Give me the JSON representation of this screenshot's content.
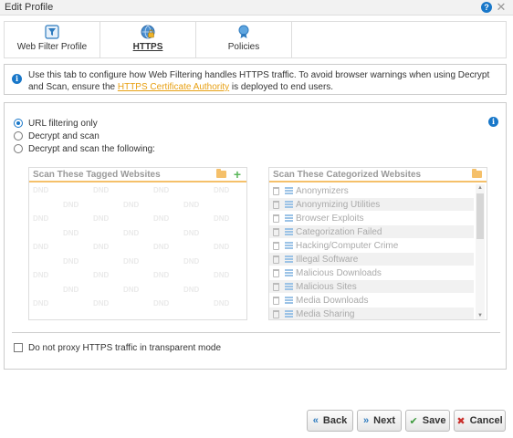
{
  "window": {
    "title": "Edit Profile",
    "help_label": "?",
    "close_label": "✕"
  },
  "tabs": [
    {
      "label": "Web Filter Profile",
      "icon": "funnel-icon",
      "active": false
    },
    {
      "label": "HTTPS",
      "icon": "lock-globe-icon",
      "active": true
    },
    {
      "label": "Policies",
      "icon": "ribbon-icon",
      "active": false
    }
  ],
  "info": {
    "text_before": "Use this tab to configure how Web Filtering handles HTTPS traffic. To avoid browser warnings when using Decrypt and Scan, ensure the ",
    "link": "HTTPS Certificate Authority",
    "text_after": " is deployed to end users."
  },
  "options": {
    "radios": [
      {
        "label": "URL filtering only",
        "checked": true
      },
      {
        "label": "Decrypt and scan",
        "checked": false
      },
      {
        "label": "Decrypt and scan the following:",
        "checked": false
      }
    ],
    "tagged_box_title": "Scan These Tagged Websites",
    "categorized_box_title": "Scan These Categorized Websites",
    "dnd_label": "DND",
    "categories": [
      "Anonymizers",
      "Anonymizing Utilities",
      "Browser Exploits",
      "Categorization Failed",
      "Hacking/Computer Crime",
      "Illegal Software",
      "Malicious Downloads",
      "Malicious Sites",
      "Media Downloads",
      "Media Sharing"
    ],
    "transparent_checkbox_label": "Do not proxy HTTPS traffic in transparent mode"
  },
  "buttons": {
    "back": "Back",
    "next": "Next",
    "save": "Save",
    "cancel": "Cancel"
  },
  "colors": {
    "accent_blue": "#1877c9",
    "link_orange": "#e8a013",
    "save_green": "#3c9a3c",
    "cancel_red": "#c9302c"
  }
}
